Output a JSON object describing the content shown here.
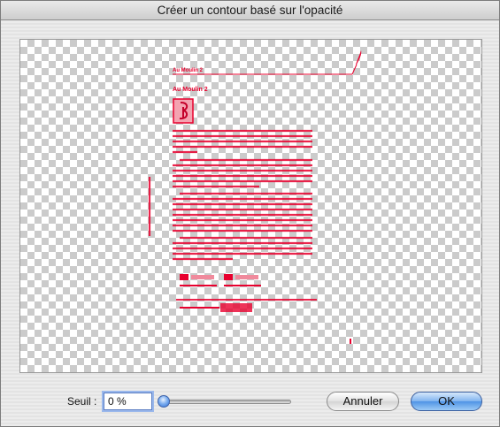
{
  "window": {
    "title": "Créer un contour basé sur l'opacité"
  },
  "preview": {
    "description_icon": "checkerboard-transparency",
    "page_header_left": "Au Moulin 2",
    "page_header_right": "Au Moulin 2",
    "accent_color": "#e8002e"
  },
  "threshold": {
    "label": "Seuil :",
    "value": "0 %",
    "slider_fraction": 0.0
  },
  "buttons": {
    "cancel_label": "Annuler",
    "ok_label": "OK"
  }
}
